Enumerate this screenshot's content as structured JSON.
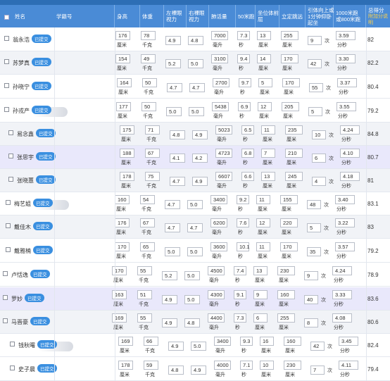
{
  "header": {
    "select_all": "",
    "name": "姓名",
    "student_id": "学籍号",
    "height": "身高",
    "weight": "体重",
    "left_eye": "左裸眼\n视力",
    "right_eye": "右裸眼\n视力",
    "lung": "肺活量",
    "run50": "50米跑",
    "sit_reach": "坐位体前\n屈",
    "long_jump": "立定跳远",
    "pullup": "引体向上或\n1分钟仰卧\n起坐",
    "run1000": "1000米跑\n或800米跑",
    "total": "总得分",
    "total_sub": "附加分说明"
  },
  "status_badge": "已提交",
  "units": {
    "height": "厘米",
    "weight": "千克",
    "lung": "毫升",
    "run50": "秒",
    "sit_reach": "厘米",
    "long_jump": "厘米",
    "pullup": "次",
    "run1000": "分秒"
  },
  "students": [
    {
      "name": "翁永浩",
      "height": "176",
      "weight": "78",
      "left_eye": "4.9",
      "right_eye": "4.8",
      "lung": "7000",
      "run50": "7.3",
      "sit_reach": "13",
      "long_jump": "255",
      "pullup": "9",
      "run1000": "3.59",
      "total": "82"
    },
    {
      "name": "苏梦真",
      "height": "154",
      "weight": "49",
      "left_eye": "5.2",
      "right_eye": "5.0",
      "lung": "3100",
      "run50": "9.4",
      "sit_reach": "14",
      "long_jump": "170",
      "pullup": "42",
      "run1000": "3.30",
      "total": "82.2"
    },
    {
      "name": "孙晓宁",
      "height": "164",
      "weight": "50",
      "left_eye": "4.7",
      "right_eye": "4.7",
      "lung": "2700",
      "run50": "9.7",
      "sit_reach": "5",
      "long_jump": "170",
      "pullup": "55",
      "run1000": "3.37",
      "total": "80.4"
    },
    {
      "name": "孙戎产",
      "height": "177",
      "weight": "50",
      "left_eye": "5.0",
      "right_eye": "5.0",
      "lung": "5438",
      "run50": "6.9",
      "sit_reach": "12",
      "long_jump": "205",
      "pullup": "5",
      "run1000": "3.55",
      "total": "79.2"
    },
    {
      "name": "易念鑫",
      "height": "175",
      "weight": "71",
      "left_eye": "4.8",
      "right_eye": "4.9",
      "lung": "5023",
      "run50": "6.5",
      "sit_reach": "11",
      "long_jump": "235",
      "pullup": "10",
      "run1000": "4.24",
      "total": "84.8"
    },
    {
      "name": "张思宇",
      "height": "188",
      "weight": "67",
      "left_eye": "4.1",
      "right_eye": "4.2",
      "lung": "4723",
      "run50": "6.8",
      "sit_reach": "7",
      "long_jump": "210",
      "pullup": "6",
      "run1000": "4.10",
      "total": "80.7"
    },
    {
      "name": "张晓蕙",
      "height": "178",
      "weight": "75",
      "left_eye": "4.7",
      "right_eye": "4.9",
      "lung": "6607",
      "run50": "6.6",
      "sit_reach": "13",
      "long_jump": "245",
      "pullup": "4",
      "run1000": "4.18",
      "total": "81"
    },
    {
      "name": "梅艺姐",
      "height": "160",
      "weight": "54",
      "left_eye": "4.7",
      "right_eye": "5.0",
      "lung": "3400",
      "run50": "9.2",
      "sit_reach": "11",
      "long_jump": "155",
      "pullup": "48",
      "run1000": "3.40",
      "total": "83.1"
    },
    {
      "name": "戴佳木",
      "height": "176",
      "weight": "67",
      "left_eye": "4.7",
      "right_eye": "4.7",
      "lung": "6200",
      "run50": "7.6",
      "sit_reach": "12",
      "long_jump": "220",
      "pullup": "5",
      "run1000": "3.22",
      "total": "83"
    },
    {
      "name": "戴雅楠",
      "height": "170",
      "weight": "65",
      "left_eye": "5.0",
      "right_eye": "5.0",
      "lung": "3600",
      "run50": "10.1",
      "sit_reach": "11",
      "long_jump": "170",
      "pullup": "35",
      "run1000": "3.57",
      "total": "79.2"
    },
    {
      "name": "卢恬逸",
      "height": "170",
      "weight": "55",
      "left_eye": "5.2",
      "right_eye": "5.0",
      "lung": "4500",
      "run50": "7.4",
      "sit_reach": "13",
      "long_jump": "230",
      "pullup": "9",
      "run1000": "4.24",
      "total": "78.9"
    },
    {
      "name": "罗妙",
      "height": "163",
      "weight": "51",
      "left_eye": "4.9",
      "right_eye": "5.0",
      "lung": "4300",
      "run50": "9.1",
      "sit_reach": "9",
      "long_jump": "160",
      "pullup": "40",
      "run1000": "3.33",
      "total": "83.6"
    },
    {
      "name": "马晋豪",
      "height": "169",
      "weight": "55",
      "left_eye": "4.9",
      "right_eye": "4.8",
      "lung": "4400",
      "run50": "7.3",
      "sit_reach": "6",
      "long_jump": "255",
      "pullup": "8",
      "run1000": "4.08",
      "total": "80.6"
    },
    {
      "name": "钱秋曙",
      "height": "169",
      "weight": "66",
      "left_eye": "4.9",
      "right_eye": "5.0",
      "lung": "3400",
      "run50": "9.3",
      "sit_reach": "16",
      "long_jump": "160",
      "pullup": "42",
      "run1000": "3.45",
      "total": "82.4"
    },
    {
      "name": "史子晨",
      "height": "178",
      "weight": "59",
      "left_eye": "4.8",
      "right_eye": "4.9",
      "lung": "4000",
      "run50": "7.1",
      "sit_reach": "10",
      "long_jump": "230",
      "pullup": "7",
      "run1000": "4.11",
      "total": "79.4"
    }
  ]
}
